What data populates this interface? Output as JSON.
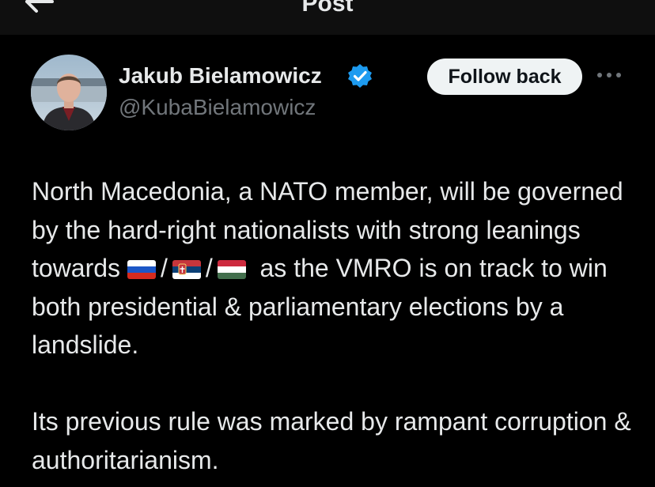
{
  "header": {
    "title": "Post",
    "back_icon": "arrow-left-icon"
  },
  "author": {
    "name": "Jakub Bielamowicz",
    "handle": "@KubaBielamowicz",
    "verified_icon": "verified-badge-icon",
    "avatar_icon": "avatar-photo"
  },
  "actions": {
    "follow_label": "Follow back",
    "more_icon": "more-options-icon"
  },
  "post": {
    "text_part1": "North Macedonia, a NATO member, will be governed by the hard-right nationalists with strong leanings towards",
    "separator": "/",
    "flags": [
      "russia-flag",
      "serbia-flag",
      "hungary-flag"
    ],
    "text_part2": "as the VMRO is on track to win both presidential & parliamentary elections by a landslide.",
    "paragraph2": "Its previous rule was marked by rampant corruption & authoritarianism."
  },
  "colors": {
    "background": "#000000",
    "text": "#e7e9ea",
    "secondary_text": "#71767b",
    "verified": "#1d9bf0",
    "follow_button_bg": "#eff3f4"
  }
}
